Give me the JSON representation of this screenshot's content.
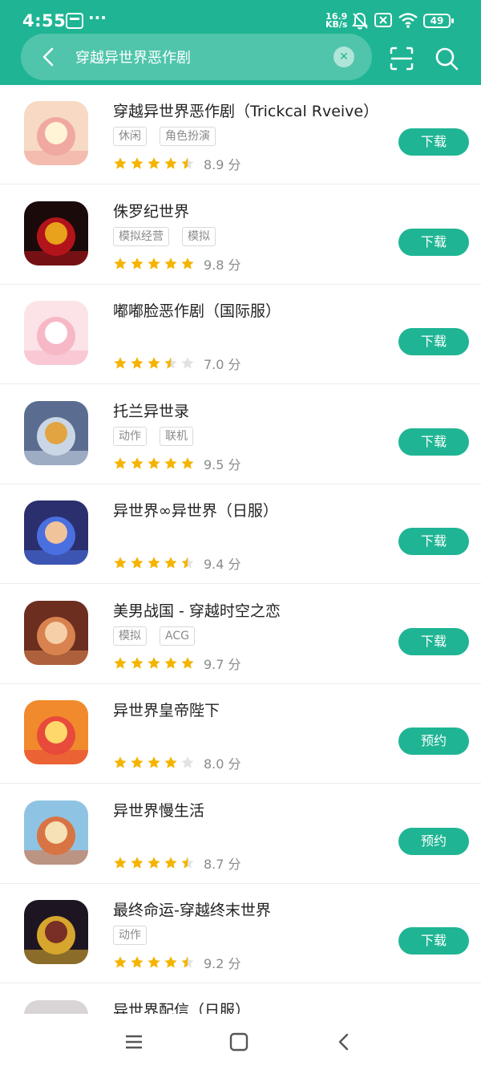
{
  "status_bar": {
    "time": "4:55",
    "speed_value": "16.9",
    "speed_unit": "KB/s",
    "battery": "49"
  },
  "search": {
    "query": "穿越异世界恶作剧"
  },
  "colors": {
    "accent": "#1fb594",
    "star": "#f5b400",
    "star_empty": "#e2e2e2"
  },
  "results": [
    {
      "name": "穿越异世界恶作剧（Trickcal Rveive）",
      "tags": [
        "休闲",
        "角色扮演"
      ],
      "rating": 4.5,
      "score": "8.9 分",
      "action": "下载"
    },
    {
      "name": "侏罗纪世界",
      "tags": [
        "模拟经营",
        "模拟"
      ],
      "rating": 5,
      "score": "9.8 分",
      "action": "下载"
    },
    {
      "name": "嘟嘟脸恶作剧（国际服）",
      "tags": [],
      "rating": 3.5,
      "score": "7.0 分",
      "action": "下载"
    },
    {
      "name": "托兰异世录",
      "tags": [
        "动作",
        "联机"
      ],
      "rating": 5,
      "score": "9.5 分",
      "action": "下载"
    },
    {
      "name": "异世界∞异世界（日服）",
      "tags": [],
      "rating": 4.5,
      "score": "9.4 分",
      "action": "下载"
    },
    {
      "name": "美男战国 - 穿越时空之恋",
      "tags": [
        "模拟",
        "ACG"
      ],
      "rating": 5,
      "score": "9.7 分",
      "action": "下载"
    },
    {
      "name": "异世界皇帝陛下",
      "tags": [],
      "rating": 4,
      "score": "8.0 分",
      "action": "预约"
    },
    {
      "name": "异世界慢生活",
      "tags": [],
      "rating": 4.5,
      "score": "8.7 分",
      "action": "预约"
    },
    {
      "name": "最终命运-穿越终末世界",
      "tags": [
        "动作"
      ],
      "rating": 4.5,
      "score": "9.2 分",
      "action": "下载"
    },
    {
      "name": "异世界配信（日服）",
      "tags": [],
      "rating": 0,
      "score": "",
      "action": ""
    }
  ],
  "icons": {
    "back": "chevron-left-icon",
    "clear": "close-icon",
    "scan": "scan-icon",
    "search": "search-icon",
    "nav_menu": "menu-icon",
    "nav_home": "home-square-icon",
    "nav_back": "back-triangle-icon"
  }
}
